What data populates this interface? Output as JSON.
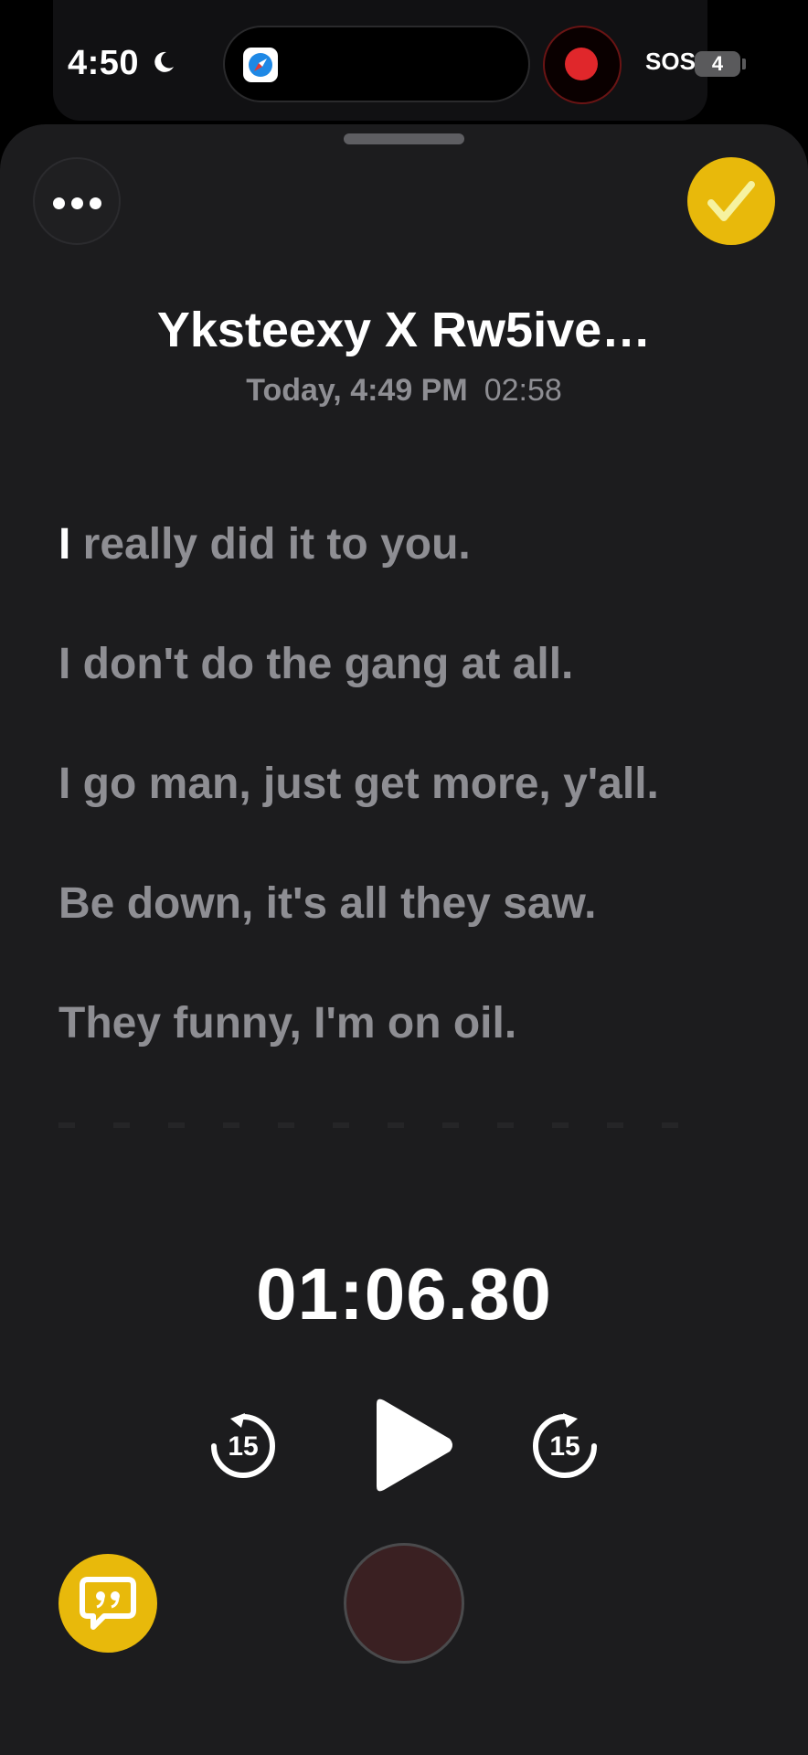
{
  "status_bar": {
    "time": "4:50",
    "sos": "SOS",
    "battery": "4"
  },
  "recording": {
    "title": "Yksteexy X Rw5ive…",
    "date": "Today, 4:49 PM",
    "duration": "02:58"
  },
  "transcript": {
    "lines": [
      {
        "highlight": "I",
        "rest": " really did it to you."
      },
      {
        "highlight": "",
        "rest": "I don't do the gang at all."
      },
      {
        "highlight": "",
        "rest": "I go man, just get more, y'all."
      },
      {
        "highlight": "",
        "rest": "Be down, it's all they saw."
      },
      {
        "highlight": "",
        "rest": "They funny, I'm on oil."
      }
    ]
  },
  "player": {
    "current_time": "01:06.80",
    "skip_back_label": "15",
    "skip_forward_label": "15"
  },
  "colors": {
    "accent": "#e8b90b",
    "record": "#e0272b",
    "sheet": "#1c1c1e",
    "dim_text": "#8e8e93"
  },
  "icons": [
    "moon-icon",
    "safari-icon",
    "record-indicator-icon",
    "more-icon",
    "checkmark-icon",
    "skip-back-15-icon",
    "play-icon",
    "skip-forward-15-icon",
    "transcript-quote-icon"
  ]
}
